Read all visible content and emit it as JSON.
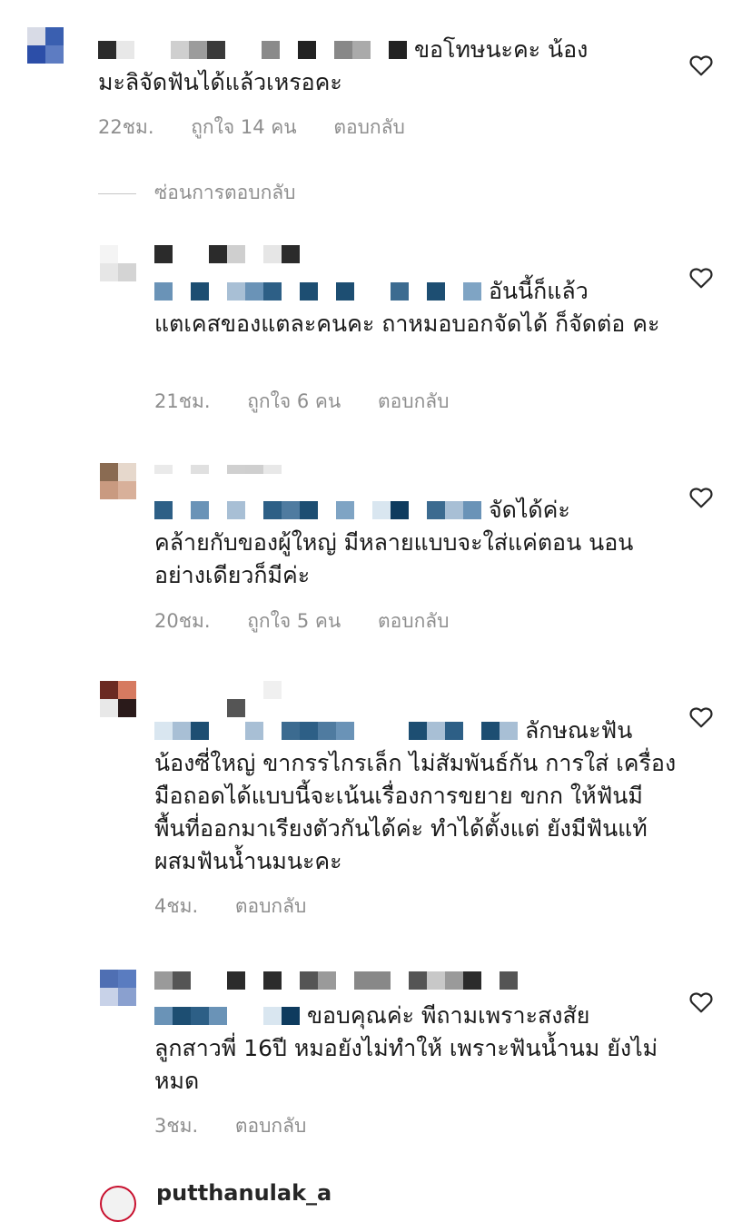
{
  "comments": [
    {
      "text_tail": "ขอโทษนะคะ น้อง",
      "text_cont": "มะลิจัดฟันได้แล้วเหรอคะ",
      "time": "22ชม.",
      "likes": "ถูกใจ 14 คน",
      "reply": "ตอบกลับ"
    },
    {
      "text_tail": "อันนี้ก็แล้ว",
      "text_cont": "แตเคสของแตละคนคะ ถาหมอบอกจัดได้ ก็จัดต่อ คะ",
      "time": "21ชม.",
      "likes": "ถูกใจ 6 คน",
      "reply": "ตอบกลับ"
    },
    {
      "text_tail": "จัดได้ค่ะ",
      "text_cont": "คล้ายกับของผู้ใหญ่ มีหลายแบบจะใส่แค่ตอน นอนอย่างเดียวก็มีค่ะ",
      "time": "20ชม.",
      "likes": "ถูกใจ 5 คน",
      "reply": "ตอบกลับ"
    },
    {
      "text_tail": "ลักษณะฟัน",
      "text_cont": "น้องซี่ใหญ่ ขากรรไกรเล็ก ไม่สัมพันธ์กัน การใส่ เครื่องมือถอดได้แบบนี้จะเน้นเรื่องการขยาย ขกก ให้ฟันมีพื้นที่ออกมาเรียงตัวกันได้ค่ะ ทำได้ตั้งแต่ ยังมีฟันแท้ผสมฟันน้ำนมนะคะ",
      "time": "4ชม.",
      "reply": "ตอบกลับ"
    },
    {
      "text_tail": "ขอบคุณค่ะ พีถามเพราะสงสัย",
      "text_cont": "ลูกสาวพี่ 16ปี หมอยังไม่ทำให้ เพราะฟันน้ำนม ยังไม่หมด",
      "time": "3ชม.",
      "reply": "ตอบกลับ"
    }
  ],
  "hide_replies": "ซ่อนการตอบกลับ",
  "partial_username": "putthanulak_a",
  "colors": {
    "meta_gray": "#8e8e8e",
    "text": "#1a1a1a",
    "blur_blue": "#2a5a80",
    "blur_gray": "#555555"
  },
  "icons": [
    "heart-icon"
  ]
}
